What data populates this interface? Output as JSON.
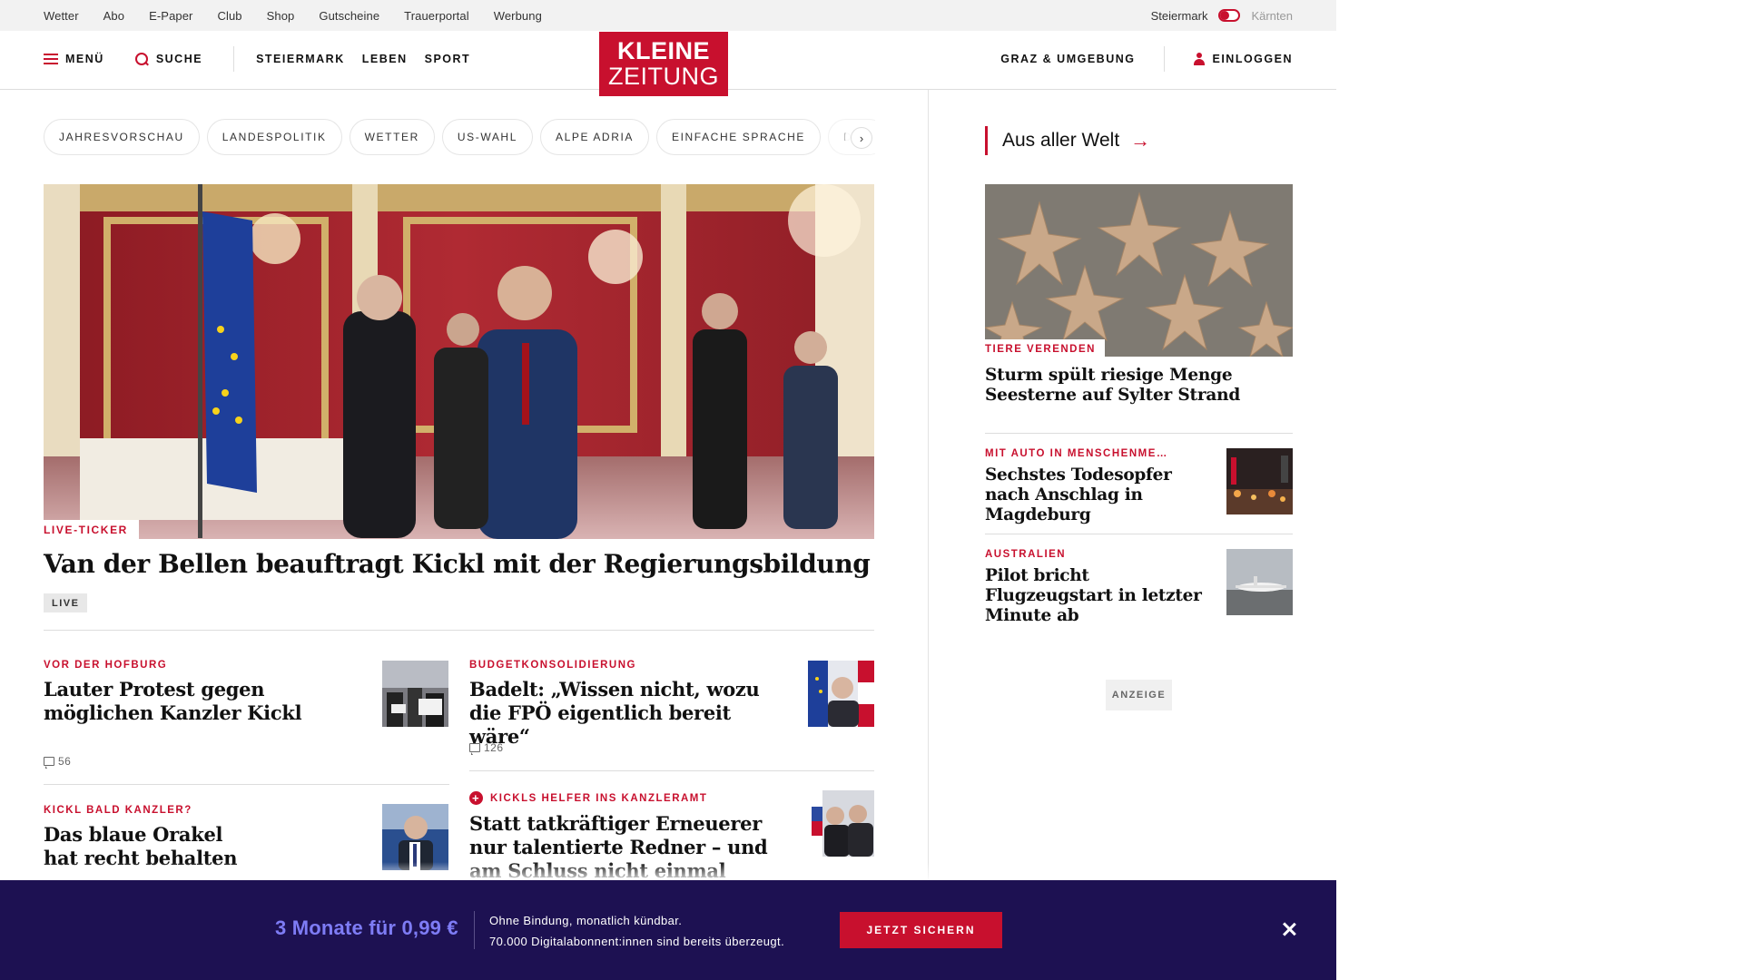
{
  "utility_bar": {
    "links": [
      "Wetter",
      "Abo",
      "E-Paper",
      "Club",
      "Shop",
      "Gutscheine",
      "Trauerportal",
      "Werbung"
    ],
    "region_active": "Steiermark",
    "region_inactive": "Kärnten"
  },
  "nav": {
    "menu_label": "MENÜ",
    "search_label": "SUCHE",
    "sections": [
      "STEIERMARK",
      "LEBEN",
      "SPORT"
    ],
    "logo_line1": "KLEINE",
    "logo_line2": "ZEITUNG",
    "region_label": "GRAZ & UMGEBUNG",
    "login_label": "EINLOGGEN"
  },
  "tags": [
    "JAHRESVORSCHAU",
    "LANDESPOLITIK",
    "WETTER",
    "US-WAHL",
    "ALPE ADRIA",
    "EINFACHE SPRACHE",
    "DOS"
  ],
  "hero": {
    "kicker": "LIVE-TICKER",
    "title": "Van der Bellen beauftragt Kickl mit der Regierungsbildung",
    "badge": "LIVE"
  },
  "articles": [
    {
      "kicker": "VOR DER HOFBURG",
      "title": "Lauter Protest gegen möglichen Kanzler Kickl",
      "comments": "56"
    },
    {
      "kicker": "BUDGETKONSOLIDIERUNG",
      "title": "Badelt: „Wissen nicht, wozu die FPÖ eigentlich bereit wäre“",
      "comments": "126"
    },
    {
      "kicker": "KICKL BALD KANZLER?",
      "title": "Das blaue Orakel hat recht behalten",
      "comments": ""
    },
    {
      "kicker": "KICKLS HELFER INS KANZLERAMT",
      "title": "Statt tatkräftiger Erneuerer nur talentierte Redner – und am Schluss nicht einmal mehr das",
      "comments": "",
      "premium": true
    }
  ],
  "right_column": {
    "header": "Aus aller Welt",
    "lead": {
      "kicker": "TIERE VERENDEN",
      "title": "Sturm spült riesige Menge Seesterne auf Sylter Strand"
    },
    "items": [
      {
        "kicker": "MIT AUTO IN MENSCHENME…",
        "title": "Sechstes Todesopfer nach Anschlag in Magdeburg"
      },
      {
        "kicker": "AUSTRALIEN",
        "title": "Pilot bricht Flugzeugstart in letzter Minute ab"
      }
    ],
    "ad_label": "ANZEIGE"
  },
  "promo": {
    "price": "3 Monate für 0,99 €",
    "line1": "Ohne Bindung, monatlich kündbar.",
    "line2": "70.000 Digitalabonnent:innen sind bereits überzeugt.",
    "button": "JETZT SICHERN"
  },
  "colors": {
    "brand_red": "#c8102e",
    "promo_bg": "#1d1152",
    "promo_price": "#7e7cf5"
  }
}
